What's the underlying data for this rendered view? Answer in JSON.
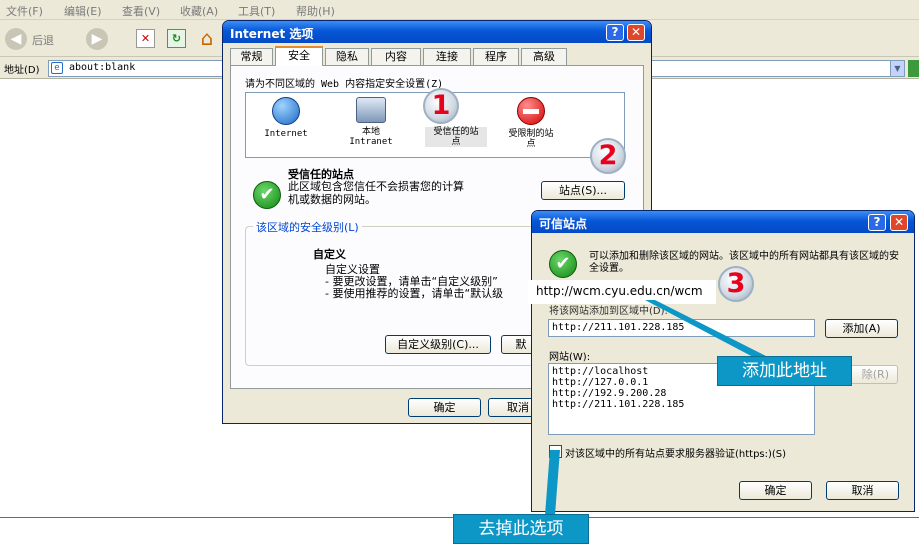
{
  "browser": {
    "menu": [
      "文件(F)",
      "编辑(E)",
      "查看(V)",
      "收藏(A)",
      "工具(T)",
      "帮助(H)"
    ],
    "back_label": "后退",
    "address_label": "地址(D)",
    "address_value": "about:blank"
  },
  "ie_options": {
    "title": "Internet 选项",
    "tabs": [
      "常规",
      "安全",
      "隐私",
      "内容",
      "连接",
      "程序",
      "高级"
    ],
    "zone_prompt": "请为不同区域的 Web 内容指定安全设置(Z)",
    "zones": [
      {
        "label": "Internet"
      },
      {
        "label": "本地\nIntranet"
      },
      {
        "label": "受信任的站\n点"
      },
      {
        "label": "受限制的站\n点"
      }
    ],
    "zone_title": "受信任的站点",
    "zone_desc": "此区域包含您信任不会损害您的计算机或数据的网站。",
    "sites_button": "站点(S)...",
    "level_group": "该区域的安全级别(L)",
    "level_title": "自定义",
    "level_lines": [
      "自定义设置",
      "- 要更改设置，请单击“自定义级别”",
      "- 要使用推荐的设置，请单击“默认级"
    ],
    "custom_button": "自定义级别(C)...",
    "default_button_partial": "默",
    "ok": "确定",
    "cancel_partial": "取消"
  },
  "trusted_sites": {
    "title": "可信站点",
    "info": "可以添加和删除该区域的网站。该区域中的所有网站都具有该区域的安全设置。",
    "add_label": "将该网站添加到区域中(D):",
    "add_value": "http://211.101.228.185",
    "add_button": "添加(A)",
    "sites_label": "网站(W):",
    "sites": [
      "http://localhost",
      "http://127.0.0.1",
      "http://192.9.200.28",
      "http://211.101.228.185"
    ],
    "remove_button_partial": "除(R)",
    "https_checkbox": "对该区域中的所有站点要求服务器验证(https:)(S)",
    "ok": "确定",
    "cancel": "取消"
  },
  "annotations": {
    "url": "http://wcm.cyu.edu.cn/wcm",
    "step1": "1",
    "step2": "2",
    "step3": "3",
    "add_this": "添加此地址",
    "remove_option": "去掉此选项"
  }
}
